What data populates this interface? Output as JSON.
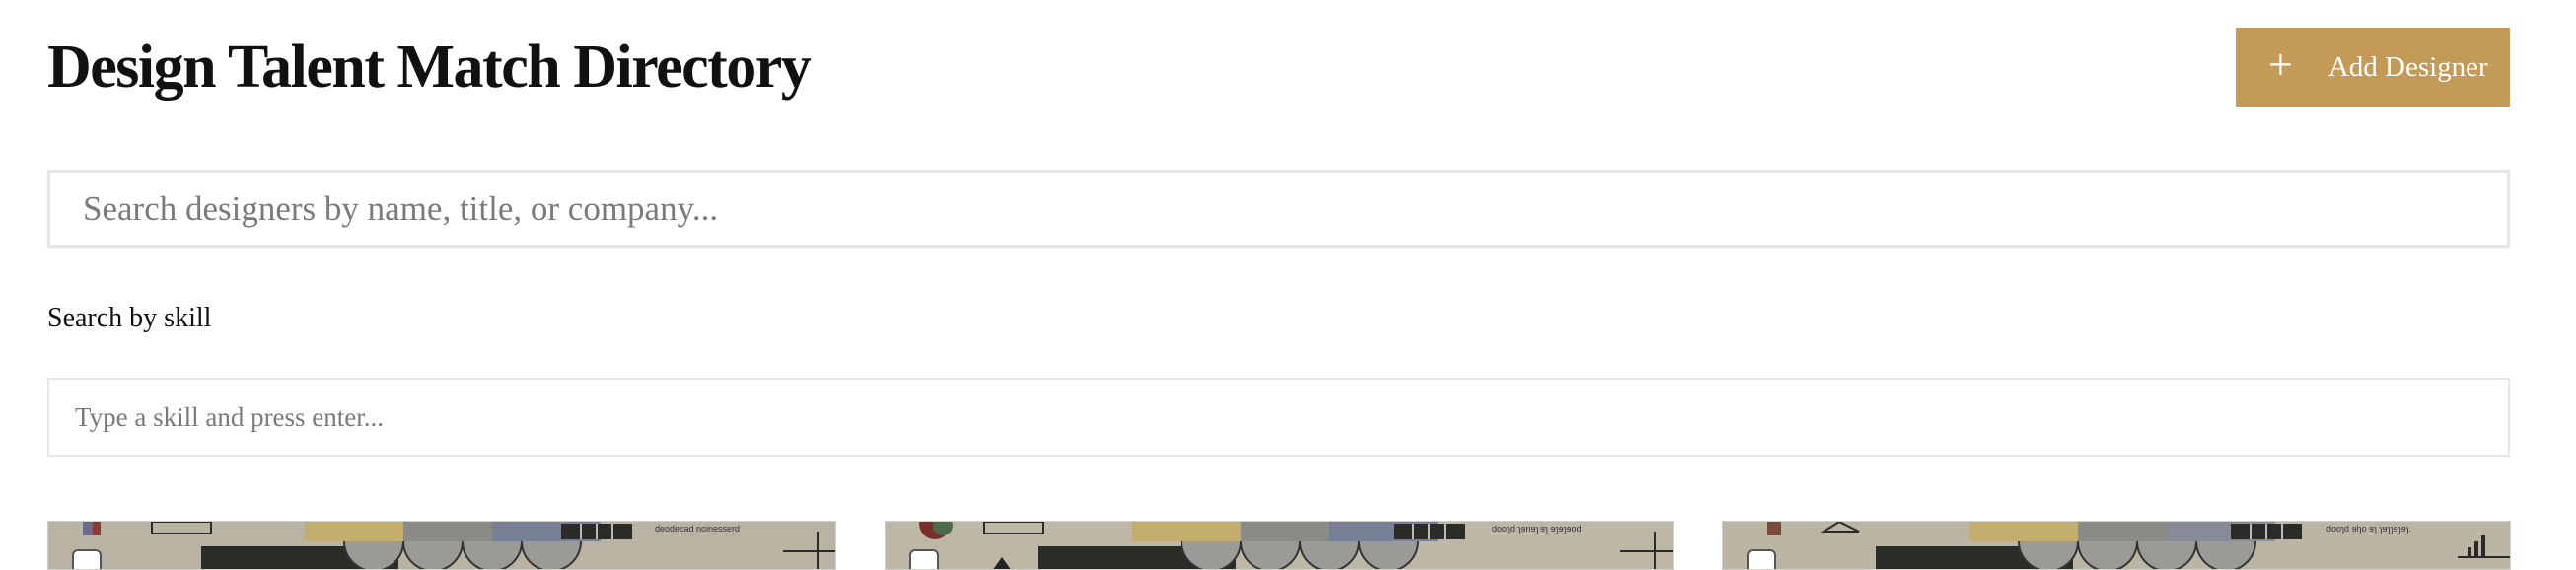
{
  "header": {
    "title": "Design Talent Match Directory",
    "add_button_label": "Add Designer",
    "add_icon": "plus-icon",
    "accent_color": "#c39a56"
  },
  "search": {
    "placeholder": "Search designers by name, title, or company..."
  },
  "skill_search": {
    "label": "Search by skill",
    "placeholder": "Type a skill and press enter..."
  },
  "cards": [
    {
      "cover_caption": "deodecad noinesserd"
    },
    {
      "cover_caption": "dooɿd ɿɘnɘɿ ɘɿ ɘɿɘɿɘod"
    },
    {
      "cover_caption": "dooɿd ɘlɿo ɘɿ ɿɘɿɿɘɿɘɿ."
    }
  ]
}
